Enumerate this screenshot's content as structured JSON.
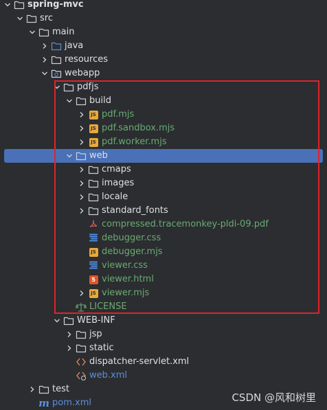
{
  "tree": {
    "rows": [
      {
        "label": "spring-mvc",
        "depth": 0,
        "expanded": true,
        "icon": "folder",
        "color": "#dfe1e5",
        "bold": true
      },
      {
        "label": "src",
        "depth": 1,
        "expanded": true,
        "icon": "folder",
        "color": "#dfe1e5"
      },
      {
        "label": "main",
        "depth": 2,
        "expanded": true,
        "icon": "folder",
        "color": "#dfe1e5"
      },
      {
        "label": "java",
        "depth": 3,
        "expanded": false,
        "icon": "folder-source",
        "color": "#dfe1e5"
      },
      {
        "label": "resources",
        "depth": 3,
        "expanded": false,
        "icon": "folder-resources",
        "color": "#dfe1e5"
      },
      {
        "label": "webapp",
        "depth": 3,
        "expanded": true,
        "icon": "folder-web",
        "color": "#dfe1e5"
      },
      {
        "label": "pdfjs",
        "depth": 4,
        "expanded": true,
        "icon": "folder",
        "color": "#dfe1e5"
      },
      {
        "label": "build",
        "depth": 5,
        "expanded": true,
        "icon": "folder",
        "color": "#dfe1e5"
      },
      {
        "label": "pdf.mjs",
        "depth": 6,
        "expanded": false,
        "icon": "js",
        "color": "#6aab73"
      },
      {
        "label": "pdf.sandbox.mjs",
        "depth": 6,
        "expanded": false,
        "icon": "js",
        "color": "#6aab73"
      },
      {
        "label": "pdf.worker.mjs",
        "depth": 6,
        "expanded": false,
        "icon": "js",
        "color": "#6aab73"
      },
      {
        "label": "web",
        "depth": 5,
        "expanded": true,
        "icon": "folder",
        "color": "#dfe1e5",
        "selected": true
      },
      {
        "label": "cmaps",
        "depth": 6,
        "expanded": false,
        "icon": "folder",
        "color": "#dfe1e5"
      },
      {
        "label": "images",
        "depth": 6,
        "expanded": false,
        "icon": "folder",
        "color": "#dfe1e5"
      },
      {
        "label": "locale",
        "depth": 6,
        "expanded": false,
        "icon": "folder",
        "color": "#dfe1e5"
      },
      {
        "label": "standard_fonts",
        "depth": 6,
        "expanded": false,
        "icon": "folder",
        "color": "#dfe1e5"
      },
      {
        "label": "compressed.tracemonkey-pldi-09.pdf",
        "depth": 6,
        "icon": "pdf",
        "color": "#6aab73"
      },
      {
        "label": "debugger.css",
        "depth": 6,
        "icon": "css",
        "color": "#6aab73"
      },
      {
        "label": "debugger.mjs",
        "depth": 6,
        "icon": "js",
        "color": "#6aab73"
      },
      {
        "label": "viewer.css",
        "depth": 6,
        "icon": "css",
        "color": "#6aab73"
      },
      {
        "label": "viewer.html",
        "depth": 6,
        "icon": "html",
        "color": "#6aab73"
      },
      {
        "label": "viewer.mjs",
        "depth": 6,
        "expanded": false,
        "icon": "js",
        "color": "#6aab73"
      },
      {
        "label": "LICENSE",
        "depth": 5,
        "icon": "license",
        "color": "#6aab73"
      },
      {
        "label": "WEB-INF",
        "depth": 4,
        "expanded": true,
        "icon": "folder",
        "color": "#dfe1e5"
      },
      {
        "label": "jsp",
        "depth": 5,
        "expanded": false,
        "icon": "folder",
        "color": "#dfe1e5"
      },
      {
        "label": "static",
        "depth": 5,
        "expanded": false,
        "icon": "folder",
        "color": "#dfe1e5"
      },
      {
        "label": "dispatcher-servlet.xml",
        "depth": 5,
        "icon": "xml",
        "color": "#dfe1e5"
      },
      {
        "label": "web.xml",
        "depth": 5,
        "icon": "xml-web",
        "color": "#5b8fe0"
      },
      {
        "label": "test",
        "depth": 2,
        "expanded": false,
        "icon": "folder",
        "color": "#dfe1e5"
      },
      {
        "label": "pom.xml",
        "depth": 2,
        "icon": "maven",
        "color": "#5b8fe0"
      }
    ]
  },
  "watermark": "CSDN @风和树里",
  "colors": {
    "background": "#2b2d30",
    "selection": "#4a71b8",
    "highlight": "#e0232b",
    "folder_stroke": "#ced0d6",
    "source_folder": "#5b8fe0",
    "css_icon": "#4d8ce8",
    "license_icon": "#6aab73"
  }
}
